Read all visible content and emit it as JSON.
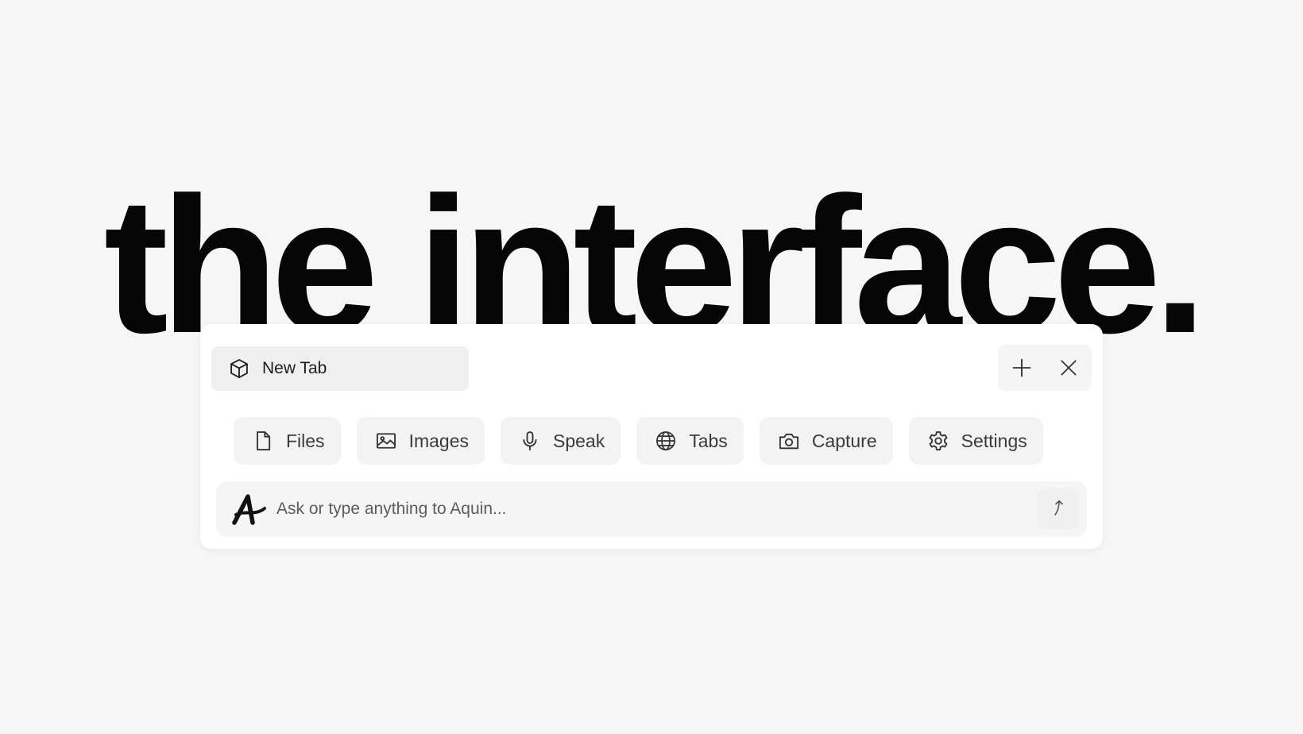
{
  "headline": "the interface.",
  "tab": {
    "label": "New Tab",
    "icon": "cube-icon"
  },
  "window_controls": {
    "add_icon": "plus-icon",
    "close_icon": "close-icon"
  },
  "actions": [
    {
      "label": "Files",
      "icon": "file-icon"
    },
    {
      "label": "Images",
      "icon": "image-icon"
    },
    {
      "label": "Speak",
      "icon": "microphone-icon"
    },
    {
      "label": "Tabs",
      "icon": "globe-icon"
    },
    {
      "label": "Capture",
      "icon": "camera-icon"
    },
    {
      "label": "Settings",
      "icon": "gear-icon"
    }
  ],
  "prompt": {
    "placeholder": "Ask or type anything to Aquin...",
    "logo_icon": "aquin-logo-icon",
    "send_icon": "send-arrow-icon"
  },
  "colors": {
    "background": "#f6f6f6",
    "headline": "#060606",
    "panel": "#ffffff",
    "chip": "#f3f3f3"
  }
}
